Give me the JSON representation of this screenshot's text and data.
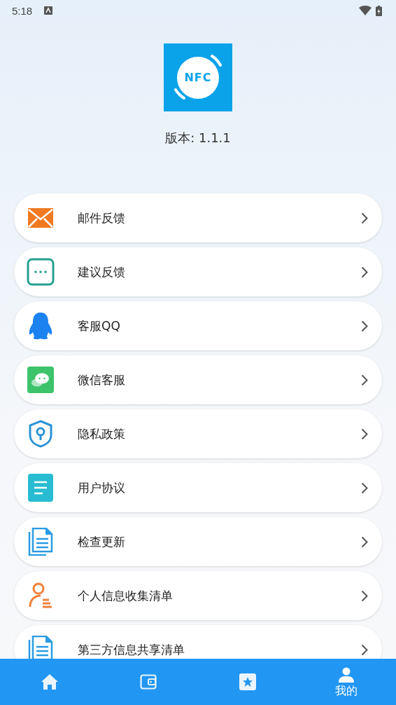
{
  "status_bar": {
    "time": "5:18"
  },
  "app": {
    "logo_text": "NFC",
    "version": "版本: 1.1.1"
  },
  "menu": [
    {
      "label": "邮件反馈"
    },
    {
      "label": "建议反馈"
    },
    {
      "label": "客服QQ"
    },
    {
      "label": "微信客服"
    },
    {
      "label": "隐私政策"
    },
    {
      "label": "用户协议"
    },
    {
      "label": "检查更新"
    },
    {
      "label": "个人信息收集清单"
    },
    {
      "label": "第三方信息共享清单"
    }
  ],
  "bottom_nav": [
    {
      "selected": false
    },
    {
      "selected": false
    },
    {
      "selected": false
    },
    {
      "label": "我的",
      "selected": true
    }
  ]
}
